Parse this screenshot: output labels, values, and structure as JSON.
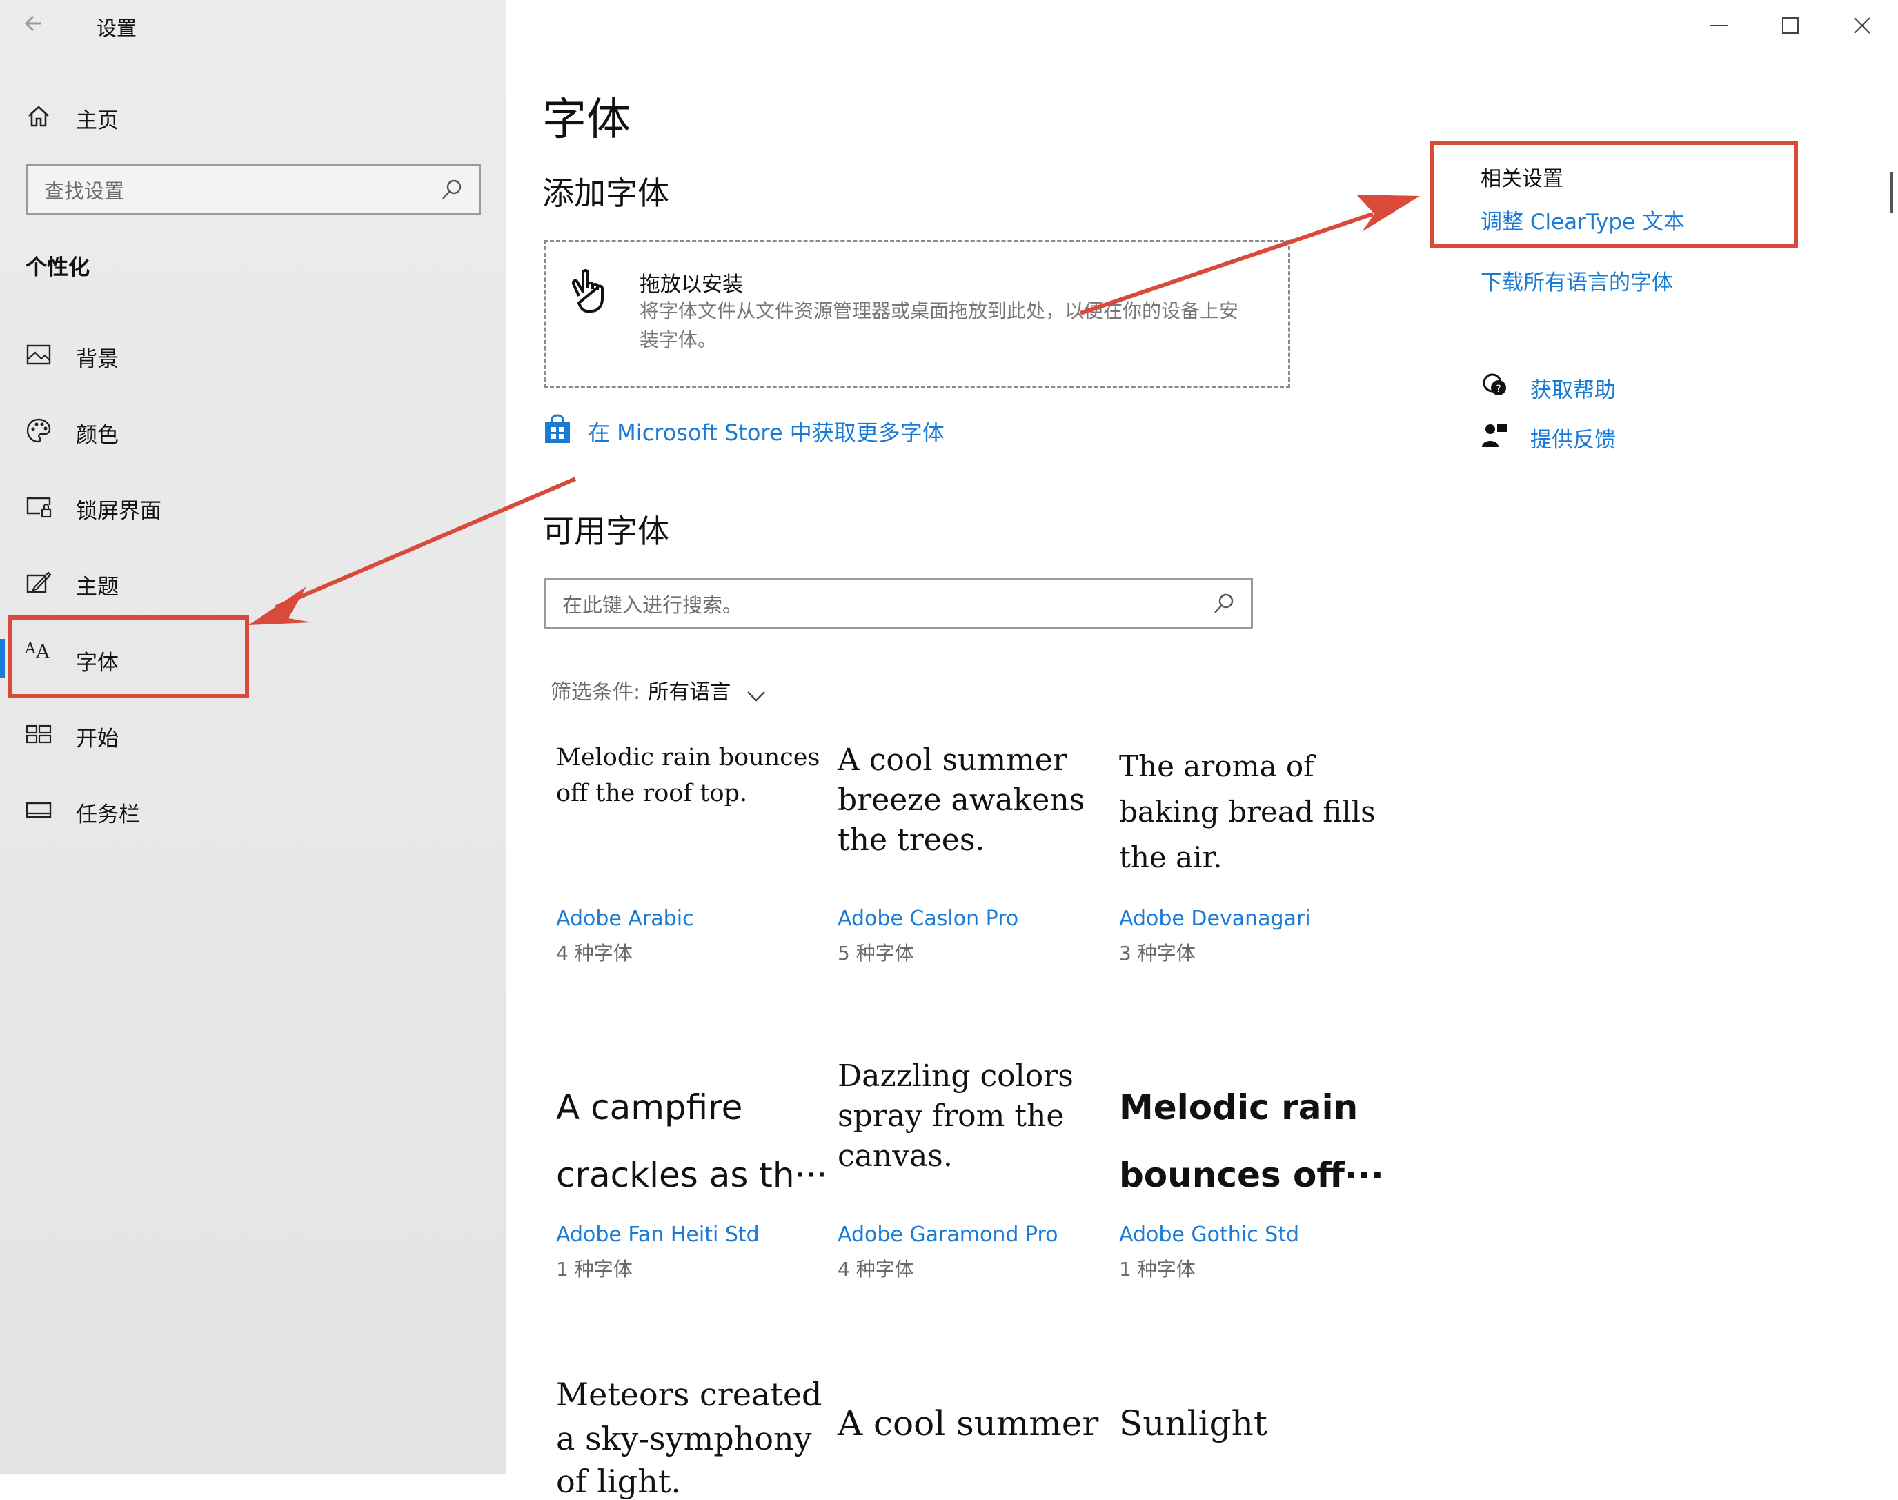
{
  "window": {
    "title": "设置",
    "back_icon": "back-arrow-icon"
  },
  "sidebar": {
    "home": "主页",
    "search_placeholder": "查找设置",
    "section": "个性化",
    "items": [
      {
        "label": "背景",
        "icon": "picture-icon"
      },
      {
        "label": "颜色",
        "icon": "palette-icon"
      },
      {
        "label": "锁屏界面",
        "icon": "lockscreen-icon"
      },
      {
        "label": "主题",
        "icon": "theme-icon"
      },
      {
        "label": "字体",
        "icon": "font-icon",
        "selected": true
      },
      {
        "label": "开始",
        "icon": "start-icon"
      },
      {
        "label": "任务栏",
        "icon": "taskbar-icon"
      }
    ]
  },
  "main": {
    "title": "字体",
    "add_heading": "添加字体",
    "drop": {
      "title": "拖放以安装",
      "desc_line1": "将字体文件从文件资源管理器或桌面拖放到此处，以便在你的设备上安",
      "desc_line2": "装字体。"
    },
    "store_link": "在 Microsoft Store 中获取更多字体",
    "available_heading": "可用字体",
    "search_placeholder": "在此键入进行搜索。",
    "filter_label": "筛选条件:",
    "filter_value": "所有语言",
    "fonts": [
      {
        "sample_l1": "Melodic rain bounces",
        "sample_l2": "off the roof top.",
        "sample_l3": "",
        "name": "Adobe Arabic",
        "count": "4 种字体"
      },
      {
        "sample_l1": "A cool summer",
        "sample_l2": "breeze awakens",
        "sample_l3": "the trees.",
        "name": "Adobe Caslon Pro",
        "count": "5 种字体"
      },
      {
        "sample_l1": "The aroma of",
        "sample_l2": "baking bread fills",
        "sample_l3": "the air.",
        "name": "Adobe Devanagari",
        "count": "3 种字体"
      },
      {
        "sample_l1": "A campfire",
        "sample_l2": "crackles as th···",
        "sample_l3": "",
        "name": "Adobe Fan Heiti Std",
        "count": "1 种字体"
      },
      {
        "sample_l1": "Dazzling colors",
        "sample_l2": "spray from the",
        "sample_l3": "canvas.",
        "name": "Adobe Garamond Pro",
        "count": "4 种字体"
      },
      {
        "sample_l1": "Melodic rain",
        "sample_l2": "bounces off···",
        "sample_l3": "",
        "name": "Adobe Gothic Std",
        "count": "1 种字体"
      },
      {
        "sample_l1": "Meteors created",
        "sample_l2": "a sky-symphony",
        "sample_l3": "of light.",
        "name": "",
        "count": ""
      },
      {
        "sample_l1": "A cool summer",
        "sample_l2": "",
        "sample_l3": "",
        "name": "",
        "count": ""
      },
      {
        "sample_l1": "Sunlight",
        "sample_l2": "",
        "sample_l3": "",
        "name": "",
        "count": ""
      }
    ]
  },
  "related": {
    "heading": "相关设置",
    "cleartype": "调整 ClearType 文本",
    "download_all": "下载所有语言的字体",
    "help": "获取帮助",
    "feedback": "提供反馈"
  },
  "colors": {
    "accent": "#1a7bd6",
    "annotation": "#d94a3a"
  }
}
